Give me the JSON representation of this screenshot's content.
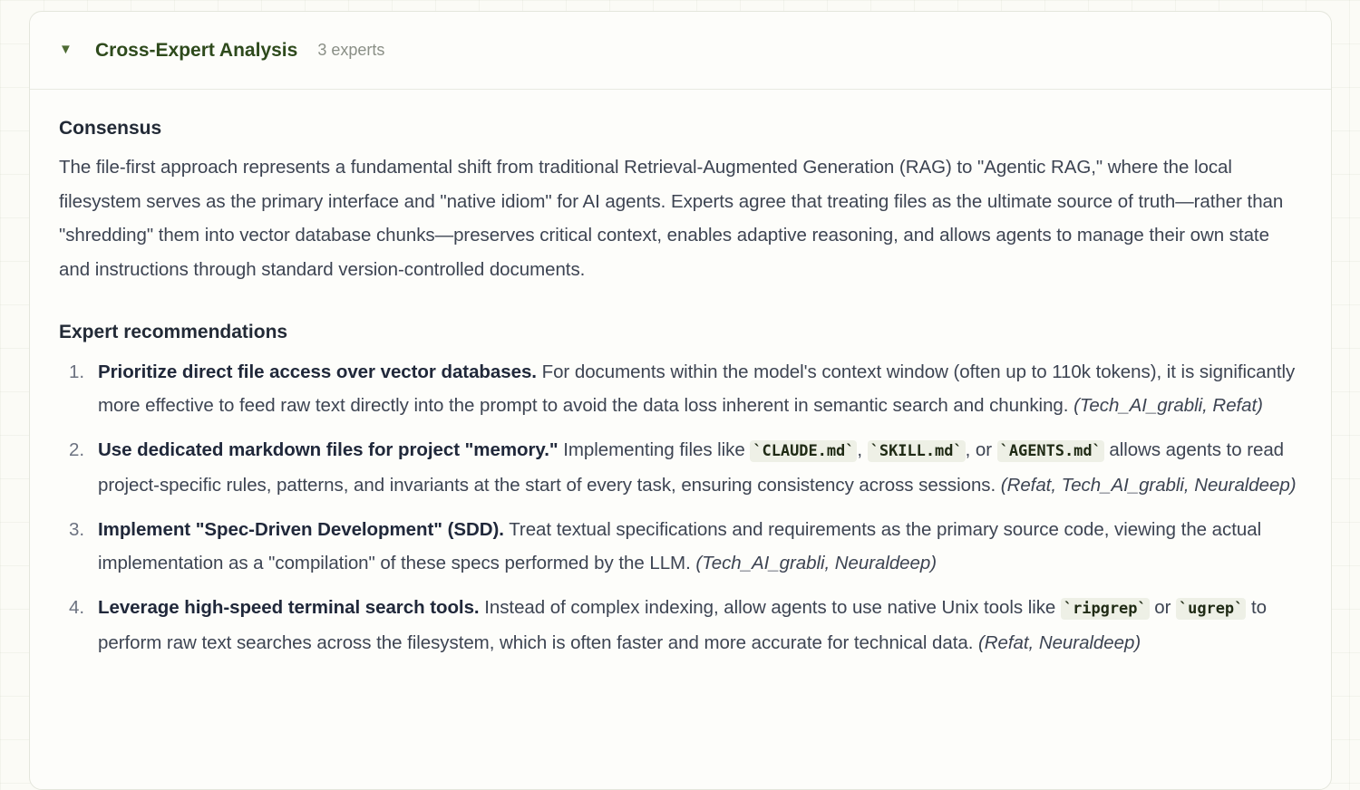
{
  "header": {
    "title": "Cross-Expert Analysis",
    "count": "3 experts",
    "chevron_icon": "caret-down-icon"
  },
  "consensus": {
    "heading": "Consensus",
    "text": "The file-first approach represents a fundamental shift from traditional Retrieval-Augmented Generation (RAG) to \"Agentic RAG,\" where the local filesystem serves as the primary interface and \"native idiom\" for AI agents. Experts agree that treating files as the ultimate source of truth—rather than \"shredding\" them into vector database chunks—preserves critical context, enables adaptive reasoning, and allows agents to manage their own state and instructions through standard version-controlled documents."
  },
  "recommendations": {
    "heading": "Expert recommendations",
    "items": [
      {
        "number": "1.",
        "lead": "Prioritize direct file access over vector databases.",
        "text": " For documents within the model's context window (often up to 110k tokens), it is significantly more effective to feed raw text directly into the prompt to avoid the data loss inherent in semantic search and chunking. ",
        "cite": "(Tech_AI_grabli, Refat)"
      },
      {
        "number": "2.",
        "lead": "Use dedicated markdown files for project \"memory.\"",
        "text_a": " Implementing files like ",
        "code1": "`CLAUDE.md`",
        "sep1": ", ",
        "code2": "`SKILL.md`",
        "sep2": ", or ",
        "code3": "`AGENTS.md`",
        "text_b": " allows agents to read project-specific rules, patterns, and invariants at the start of every task, ensuring consistency across sessions. ",
        "cite": "(Refat, Tech_AI_grabli, Neuraldeep)"
      },
      {
        "number": "3.",
        "lead": "Implement \"Spec-Driven Development\" (SDD).",
        "text": " Treat textual specifications and requirements as the primary source code, viewing the actual implementation as a \"compilation\" of these specs performed by the LLM. ",
        "cite": "(Tech_AI_grabli, Neuraldeep)"
      },
      {
        "number": "4.",
        "lead": "Leverage high-speed terminal search tools.",
        "text_a": " Instead of complex indexing, allow agents to use native Unix tools like ",
        "code1": "`ripgrep`",
        "sep1": " or ",
        "code2": "`ugrep`",
        "text_b": " to perform raw text searches across the filesystem, which is often faster and more accurate for technical data. ",
        "cite": "(Refat, Neuraldeep)"
      }
    ]
  }
}
